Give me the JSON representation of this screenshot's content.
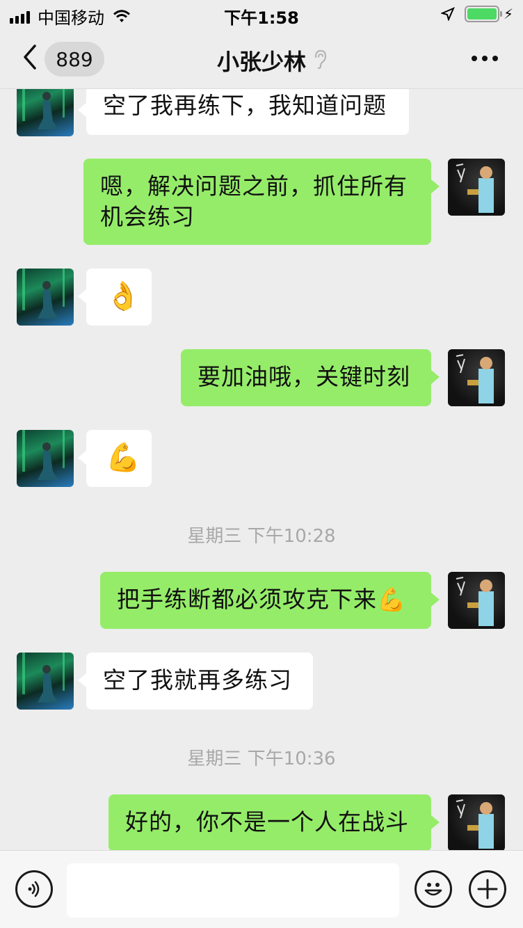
{
  "status_bar": {
    "carrier": "中国移动",
    "time": "下午1:58"
  },
  "nav": {
    "unread_count": "889",
    "title": "小张少林"
  },
  "messages": [
    {
      "from": "them",
      "text": "空了我再练下，我知道问题"
    },
    {
      "from": "me",
      "line1": "嗯，解决问题之前，抓住所有",
      "line2": "机会练习"
    },
    {
      "from": "them",
      "text": "👌"
    },
    {
      "from": "me",
      "text": "要加油哦，关键时刻"
    },
    {
      "from": "them",
      "text": "💪"
    },
    {
      "from": "me",
      "text": "把手练断都必须攻克下来💪"
    },
    {
      "from": "them",
      "text": "空了我就再多练习"
    },
    {
      "from": "me",
      "text": "好的，你不是一个人在战斗"
    }
  ],
  "timestamps": [
    "星期三 下午10:28",
    "星期三 下午10:36"
  ],
  "input": {
    "placeholder": "",
    "voice_icon": "voice-icon",
    "emoji_icon": "emoji-icon",
    "plus_icon": "plus-icon"
  },
  "colors": {
    "my_bubble": "#95ec69",
    "their_bubble": "#ffffff",
    "background": "#ededed"
  }
}
